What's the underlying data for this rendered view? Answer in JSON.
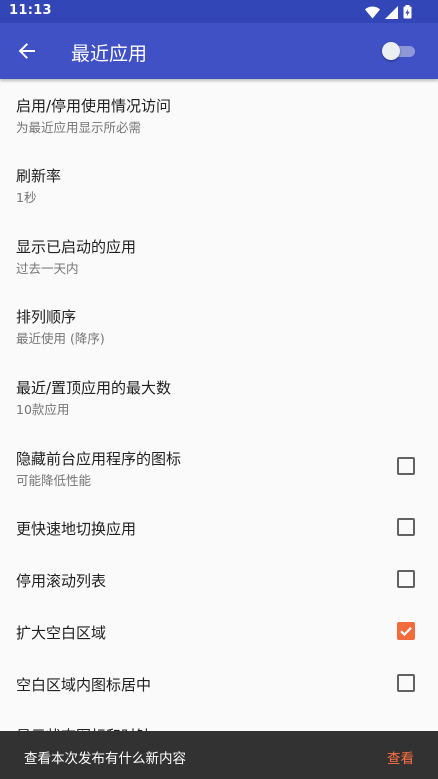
{
  "status_bar": {
    "time": "11:13",
    "icons": [
      "wifi-icon",
      "signal-icon",
      "battery-icon"
    ]
  },
  "app_bar": {
    "title": "最近应用",
    "back_icon": "arrow-back-icon",
    "master_toggle": {
      "on": false
    }
  },
  "settings": [
    {
      "title": "启用/停用使用情况访问",
      "summary": "为最近应用显示所必需"
    },
    {
      "title": "刷新率",
      "summary": "1秒"
    },
    {
      "title": "显示已启动的应用",
      "summary": "过去一天内"
    },
    {
      "title": "排列顺序",
      "summary": "最近使用 (降序)"
    },
    {
      "title": "最近/置顶应用的最大数",
      "summary": "10款应用"
    },
    {
      "title": "隐藏前台应用程序的图标",
      "summary": "可能降低性能",
      "checked": false
    },
    {
      "title": "更快速地切换应用",
      "checked": false
    },
    {
      "title": "停用滚动列表",
      "checked": false
    },
    {
      "title": "扩大空白区域",
      "checked": true
    },
    {
      "title": "空白区域内图标居中",
      "checked": false
    }
  ],
  "partial_item_title": "显示状态图标和时钟",
  "snackbar": {
    "message": "查看本次发布有什么新内容",
    "action": "查看"
  },
  "colors": {
    "status_bar": "#3346b8",
    "app_bar": "#3f51c5",
    "accent": "#f26b3a",
    "snackbar": "#323232"
  }
}
